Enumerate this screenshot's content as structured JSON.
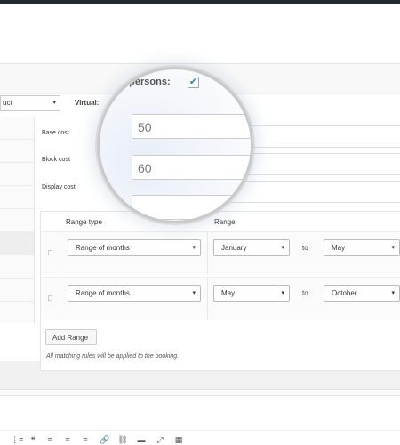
{
  "product_select": {
    "value": "uct",
    "arrow": "▾"
  },
  "virtual_label": "Virtual:",
  "magnifier": {
    "persons_label": "e persons:",
    "checkbox_mark": "✔",
    "zoom_base_cost": "50",
    "zoom_block_cost": "60"
  },
  "fields": {
    "base_cost_label": "Base cost",
    "block_cost_label": "Block cost",
    "display_cost_label": "Display cost"
  },
  "rules": {
    "range_type_header": "Range type",
    "range_header": "Range",
    "rows": [
      {
        "type": "Range of months",
        "from": "January",
        "to_word": "to",
        "to": "May"
      },
      {
        "type": "Range of months",
        "from": "May",
        "to_word": "to",
        "to": "October"
      }
    ],
    "add_button": "Add Range",
    "note": "All matching rules will be applied to the booking."
  },
  "toolbar": {
    "icons": [
      "⋮≡",
      "❝",
      "≡",
      "≡",
      "≡",
      "🔗",
      "⛓",
      "▬",
      "⤢",
      "▦"
    ]
  }
}
